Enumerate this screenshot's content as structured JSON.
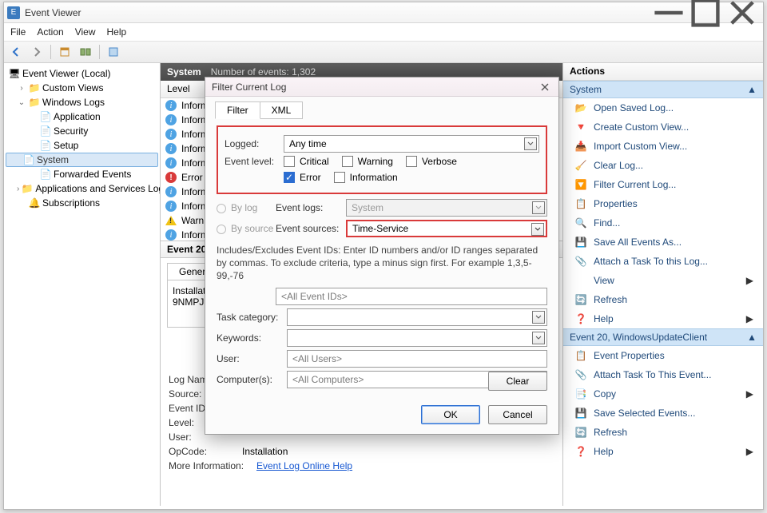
{
  "window": {
    "title": "Event Viewer"
  },
  "menu": {
    "file": "File",
    "action": "Action",
    "view": "View",
    "help": "Help"
  },
  "tree": {
    "root": "Event Viewer (Local)",
    "custom": "Custom Views",
    "winlogs": "Windows Logs",
    "application": "Application",
    "security": "Security",
    "setup": "Setup",
    "system": "System",
    "forwarded": "Forwarded Events",
    "appsvc": "Applications and Services Logs",
    "subs": "Subscriptions"
  },
  "center": {
    "title": "System",
    "count_label": "Number of events: 1,302",
    "col_level": "Level",
    "rows": [
      "Informa",
      "Informa",
      "Informa",
      "Informa",
      "Informa",
      "Error",
      "Informa",
      "Informa",
      "Warning",
      "Informa",
      "Informa"
    ],
    "detail_title": "Event 20, W",
    "tab_general": "General",
    "detail_text": "Installati\n9NMPJ9",
    "kv": {
      "logname": "Log Nam",
      "source": "Source:",
      "eventid": "Event ID:",
      "level": "Level:",
      "user": "User:",
      "opcode": "OpCode:",
      "opcode_val": "Installation",
      "moreinfo": "More Information:",
      "moreinfo_link": "Event Log Online Help"
    }
  },
  "actions": {
    "title": "Actions",
    "sec_system": "System",
    "open_saved": "Open Saved Log...",
    "create_custom": "Create Custom View...",
    "import_custom": "Import Custom View...",
    "clear_log": "Clear Log...",
    "filter_current": "Filter Current Log...",
    "properties": "Properties",
    "find": "Find...",
    "save_all": "Save All Events As...",
    "attach_task_log": "Attach a Task To this Log...",
    "view": "View",
    "refresh": "Refresh",
    "help": "Help",
    "sec_event": "Event 20, WindowsUpdateClient",
    "event_props": "Event Properties",
    "attach_task_event": "Attach Task To This Event...",
    "copy": "Copy",
    "save_selected": "Save Selected Events...",
    "refresh2": "Refresh",
    "help2": "Help"
  },
  "dialog": {
    "title": "Filter Current Log",
    "tab_filter": "Filter",
    "tab_xml": "XML",
    "logged": "Logged:",
    "logged_val": "Any time",
    "event_level": "Event level:",
    "lv_critical": "Critical",
    "lv_warning": "Warning",
    "lv_verbose": "Verbose",
    "lv_error": "Error",
    "lv_information": "Information",
    "by_log": "By log",
    "by_source": "By source",
    "event_logs": "Event logs:",
    "event_logs_val": "System",
    "event_sources": "Event sources:",
    "event_sources_val": "Time-Service",
    "hint": "Includes/Excludes Event IDs: Enter ID numbers and/or ID ranges separated by commas. To exclude criteria, type a minus sign first. For example 1,3,5-99,-76",
    "all_event_ids": "<All Event IDs>",
    "task_cat": "Task category:",
    "keywords": "Keywords:",
    "user": "User:",
    "user_val": "<All Users>",
    "computers": "Computer(s):",
    "computers_val": "<All Computers>",
    "clear": "Clear",
    "ok": "OK",
    "cancel": "Cancel"
  }
}
